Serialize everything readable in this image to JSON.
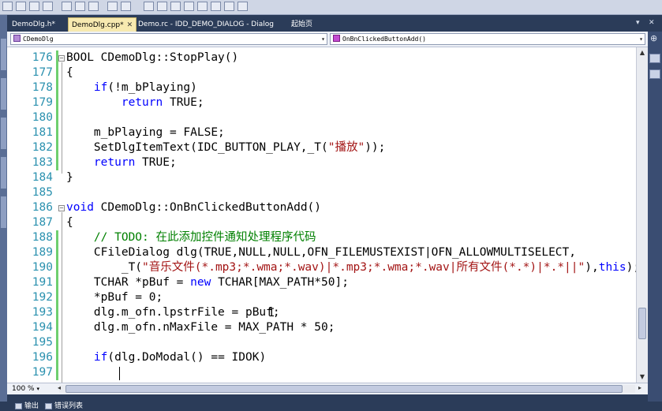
{
  "window": {
    "tabs": [
      {
        "label": "DemoDlg.h*",
        "active": false
      },
      {
        "label": "DemoDlg.cpp*",
        "active": true,
        "close": "✕"
      },
      {
        "label": "Demo.rc - IDD_DEMO_DIALOG - Dialog",
        "active": false
      },
      {
        "label": "起始页",
        "active": false
      }
    ],
    "tab_controls": {
      "dropdown": "▾",
      "close": "✕"
    }
  },
  "navbar": {
    "class_combo": "CDemoDlg",
    "member_combo": "OnBnClickedButtonAdd()"
  },
  "editor": {
    "zoom": "100 %",
    "lines": [
      {
        "num": "176",
        "tokens": [
          {
            "t": "BOOL CDemoDlg::StopPlay()",
            "c": ""
          }
        ]
      },
      {
        "num": "177",
        "tokens": [
          {
            "t": "{",
            "c": ""
          }
        ]
      },
      {
        "num": "178",
        "tokens": [
          {
            "t": "    ",
            "c": ""
          },
          {
            "t": "if",
            "c": "kw"
          },
          {
            "t": "(!m_bPlaying)",
            "c": ""
          }
        ]
      },
      {
        "num": "179",
        "tokens": [
          {
            "t": "        ",
            "c": ""
          },
          {
            "t": "return",
            "c": "kw"
          },
          {
            "t": " TRUE;",
            "c": ""
          }
        ]
      },
      {
        "num": "180",
        "tokens": []
      },
      {
        "num": "181",
        "tokens": [
          {
            "t": "    m_bPlaying = FALSE;",
            "c": ""
          }
        ]
      },
      {
        "num": "182",
        "tokens": [
          {
            "t": "    SetDlgItemText(IDC_BUTTON_PLAY,_T(",
            "c": ""
          },
          {
            "t": "\"播放\"",
            "c": "str"
          },
          {
            "t": "));",
            "c": ""
          }
        ]
      },
      {
        "num": "183",
        "tokens": [
          {
            "t": "    ",
            "c": ""
          },
          {
            "t": "return",
            "c": "kw"
          },
          {
            "t": " TRUE;",
            "c": ""
          }
        ]
      },
      {
        "num": "184",
        "tokens": [
          {
            "t": "}",
            "c": ""
          }
        ]
      },
      {
        "num": "185",
        "tokens": []
      },
      {
        "num": "186",
        "tokens": [
          {
            "t": "void",
            "c": "kw"
          },
          {
            "t": " CDemoDlg::OnBnClickedButtonAdd()",
            "c": ""
          }
        ]
      },
      {
        "num": "187",
        "tokens": [
          {
            "t": "{",
            "c": ""
          }
        ]
      },
      {
        "num": "188",
        "tokens": [
          {
            "t": "    ",
            "c": ""
          },
          {
            "t": "// TODO: 在此添加控件通知处理程序代码",
            "c": "cmt"
          }
        ]
      },
      {
        "num": "189",
        "tokens": [
          {
            "t": "    CFileDialog dlg(TRUE,NULL,NULL,OFN_FILEMUSTEXIST|OFN_ALLOWMULTISELECT,",
            "c": ""
          }
        ]
      },
      {
        "num": "190",
        "tokens": [
          {
            "t": "        _T(",
            "c": ""
          },
          {
            "t": "\"音乐文件(*.mp3;*.wma;*.wav)|*.mp3;*.wma;*.wav|所有文件(*.*)|*.*||\"",
            "c": "str"
          },
          {
            "t": "),",
            "c": ""
          },
          {
            "t": "this",
            "c": "kw"
          },
          {
            "t": ");",
            "c": ""
          }
        ]
      },
      {
        "num": "191",
        "tokens": [
          {
            "t": "    TCHAR *pBuf = ",
            "c": ""
          },
          {
            "t": "new",
            "c": "kw"
          },
          {
            "t": " TCHAR[MAX_PATH*50];",
            "c": ""
          }
        ]
      },
      {
        "num": "192",
        "tokens": [
          {
            "t": "    *pBuf = 0;",
            "c": ""
          }
        ]
      },
      {
        "num": "193",
        "tokens": [
          {
            "t": "    dlg.m_ofn.lpstrFile = pBuf;",
            "c": ""
          }
        ]
      },
      {
        "num": "194",
        "tokens": [
          {
            "t": "    dlg.m_ofn.nMaxFile = MAX_PATH * 50;",
            "c": ""
          }
        ]
      },
      {
        "num": "195",
        "tokens": []
      },
      {
        "num": "196",
        "tokens": [
          {
            "t": "    ",
            "c": ""
          },
          {
            "t": "if",
            "c": "kw"
          },
          {
            "t": "(dlg.DoModal() == IDOK)",
            "c": ""
          }
        ]
      },
      {
        "num": "197",
        "tokens": []
      }
    ]
  },
  "bottom_tabs": [
    {
      "label": "输出"
    },
    {
      "label": "错误列表"
    }
  ],
  "colors": {
    "keyword": "#0000ff",
    "string": "#a31515",
    "comment": "#008000",
    "line_number": "#2b91af",
    "change_bar": "#6fcf6f",
    "chrome": "#2b3c59",
    "active_tab": "#f7e9b0"
  },
  "icons": {
    "fold_open": "minus-box",
    "class_icon": "class-icon",
    "method_icon": "method-icon",
    "tab_close": "close-icon",
    "scroll_up": "▲",
    "scroll_down": "▼",
    "scroll_left": "◂",
    "scroll_right": "▸",
    "split": "⊕",
    "combo_arrow": "▾"
  }
}
